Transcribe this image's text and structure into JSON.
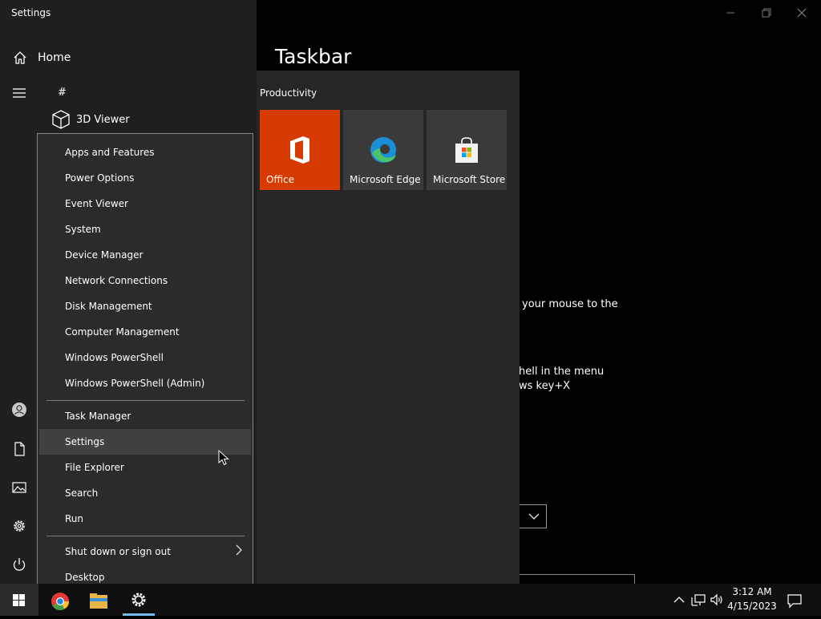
{
  "settings_window": {
    "title": "Settings",
    "home_label": "Home",
    "page_title": "Taskbar",
    "bg_text_1": "your mouse to the",
    "bg_text_2": "hell in the menu",
    "bg_text_3": "ws key+X"
  },
  "start_menu": {
    "list_header": "#",
    "apps": [
      {
        "label": "3D Viewer",
        "icon": "cube-icon"
      }
    ],
    "group_label": "Productivity",
    "tiles": [
      {
        "label": "Office",
        "icon": "office-icon",
        "color": "#d83b01"
      },
      {
        "label": "Microsoft Edge",
        "icon": "edge-icon",
        "color": "#3a3a3a"
      },
      {
        "label": "Microsoft Store",
        "icon": "store-icon",
        "color": "#3a3a3a"
      }
    ],
    "rail_icons": [
      "hamburger-icon",
      "user-icon",
      "document-icon",
      "pictures-icon",
      "gear-icon",
      "power-icon"
    ]
  },
  "context_menu": {
    "group1": [
      "Apps and Features",
      "Power Options",
      "Event Viewer",
      "System",
      "Device Manager",
      "Network Connections",
      "Disk Management",
      "Computer Management",
      "Windows PowerShell",
      "Windows PowerShell (Admin)"
    ],
    "group2": [
      "Task Manager",
      "Settings",
      "File Explorer",
      "Search",
      "Run"
    ],
    "group3": [
      "Shut down or sign out",
      "Desktop"
    ],
    "hovered": "Settings"
  },
  "taskbar": {
    "apps": [
      "chrome-icon",
      "file-explorer-icon",
      "settings-icon"
    ],
    "time": "3:12 AM",
    "date": "4/15/2023",
    "accent": "#76b9ed"
  }
}
